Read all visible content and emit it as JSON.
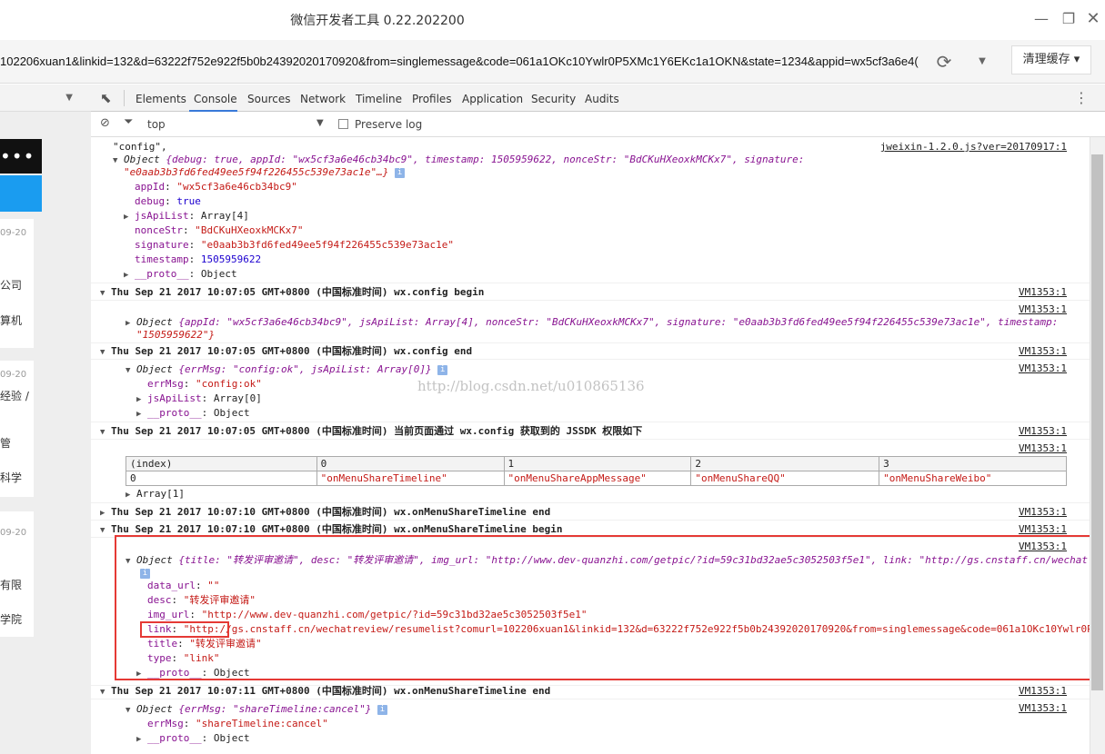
{
  "window": {
    "title": "微信开发者工具 0.22.202200"
  },
  "urlbar": {
    "url": "102206xuan1&linkid=132&d=63222f752e922f5b0b24392020170920&from=singlemessage&code=061a1OKc10Ywlr0P5XMc1Y6EKc1a1OKN&state=1234&appid=wx5cf3a6e4(",
    "clear_cache_label": "清理缓存 ▾"
  },
  "simulator": {
    "dots": "•••",
    "dates": [
      "09-20",
      "09-20",
      "09-20"
    ],
    "texts": [
      "公司",
      "算机",
      "经验 /",
      "管",
      "",
      "科学",
      "有限",
      "学院"
    ]
  },
  "devtools": {
    "tabs": [
      "Elements",
      "Console",
      "Sources",
      "Network",
      "Timeline",
      "Profiles",
      "Application",
      "Security",
      "Audits"
    ],
    "active_tab": "Console",
    "filter": {
      "context": "top",
      "preserve_log_label": "Preserve log"
    }
  },
  "console": {
    "entry1": {
      "label": "\"config\",",
      "src": "jweixin-1.2.0.js?ver=20170917:1",
      "summary_1": "{debug: true, appId: \"wx5cf3a6e46cb34bc9\", timestamp: 1505959622, nonceStr: \"BdCKuHXeoxkMCKx7\", signature:",
      "summary_2": "\"e0aab3b3fd6fed49ee5f94f226455c539e73ac1e\"…}",
      "props": [
        {
          "k": "appId",
          "v": "\"wx5cf3a6e46cb34bc9\""
        },
        {
          "k": "debug",
          "v": "true"
        },
        {
          "k": "jsApiList",
          "v": "Array[4]"
        },
        {
          "k": "nonceStr",
          "v": "\"BdCKuHXeoxkMCKx7\""
        },
        {
          "k": "signature",
          "v": "\"e0aab3b3fd6fed49ee5f94f226455c539e73ac1e\""
        },
        {
          "k": "timestamp",
          "v": "1505959622"
        },
        {
          "k": "__proto__",
          "v": "Object"
        }
      ]
    },
    "entry2": {
      "text": "Thu Sep 21 2017 10:07:05 GMT+0800 (中国标准时间) wx.config begin",
      "src": "VM1353:1",
      "src2": "VM1353:1",
      "object": "{appId: \"wx5cf3a6e46cb34bc9\", jsApiList: Array[4], nonceStr: \"BdCKuHXeoxkMCKx7\", signature: \"e0aab3b3fd6fed49ee5f94f226455c539e73ac1e\", timestamp:",
      "object_2": "\"1505959622\"}"
    },
    "entry3": {
      "text": "Thu Sep 21 2017 10:07:05 GMT+0800 (中国标准时间) wx.config end",
      "src": "VM1353:1",
      "src2": "VM1353:1",
      "object": "{errMsg: \"config:ok\", jsApiList: Array[0]}",
      "props": [
        {
          "k": "errMsg",
          "v": "\"config:ok\""
        },
        {
          "k": "jsApiList",
          "v": "Array[0]"
        },
        {
          "k": "__proto__",
          "v": "Object"
        }
      ]
    },
    "watermark": "http://blog.csdn.net/u010865136",
    "entry4": {
      "text": "Thu Sep 21 2017 10:07:05 GMT+0800 (中国标准时间) 当前页面通过 wx.config 获取到的 JSSDK 权限如下",
      "src": "VM1353:1",
      "src2": "VM1353:1",
      "table": {
        "headers": [
          "(index)",
          "0",
          "1",
          "2",
          "3"
        ],
        "row": [
          "0",
          "\"onMenuShareTimeline\"",
          "\"onMenuShareAppMessage\"",
          "\"onMenuShareQQ\"",
          "\"onMenuShareWeibo\""
        ]
      },
      "array": "Array[1]"
    },
    "entry5": {
      "text": "Thu Sep 21 2017 10:07:10 GMT+0800 (中国标准时间) wx.onMenuShareTimeline end",
      "src": "VM1353:1"
    },
    "entry6": {
      "text": "Thu Sep 21 2017 10:07:10 GMT+0800 (中国标准时间) wx.onMenuShareTimeline begin",
      "src": "VM1353:1",
      "src2": "VM1353:1",
      "object": "{title: \"转发评审邀请\", desc: \"转发评审邀请\", img_url: \"http://www.dev-quanzhi.com/getpic/?id=59c31bd32ae5c3052503f5e1\", link: \"http://gs.cnstaff.cn/wechat",
      "props": [
        {
          "k": "data_url",
          "v": "\"\""
        },
        {
          "k": "desc",
          "v": "\"转发评审邀请\""
        },
        {
          "k": "img_url",
          "v": "\"http://www.dev-quanzhi.com/getpic/?id=59c31bd32ae5c3052503f5e1\""
        },
        {
          "k": "link",
          "v": "\"http://gs.cnstaff.cn/wechatreview/resumelist?comurl=102206xuan1&linkid=132&d=63222f752e922f5b0b24392020170920&from=singlemessage&code=061a1OKc10Ywlr0P"
        },
        {
          "k": "title",
          "v": "\"转发评审邀请\""
        },
        {
          "k": "type",
          "v": "\"link\""
        },
        {
          "k": "__proto__",
          "v": "Object"
        }
      ]
    },
    "entry7": {
      "text": "Thu Sep 21 2017 10:07:11 GMT+0800 (中国标准时间) wx.onMenuShareTimeline end",
      "src": "VM1353:1",
      "src2": "VM1353:1",
      "object": "{errMsg: \"shareTimeline:cancel\"}",
      "props": [
        {
          "k": "errMsg",
          "v": "\"shareTimeline:cancel\""
        },
        {
          "k": "__proto__",
          "v": "Object"
        }
      ]
    },
    "object_label": "Object",
    "info_glyph": "i"
  },
  "colors": {
    "accent": "#3879d9",
    "highlight_box": "#e53935",
    "simulator_blue": "#1a9cf0"
  }
}
